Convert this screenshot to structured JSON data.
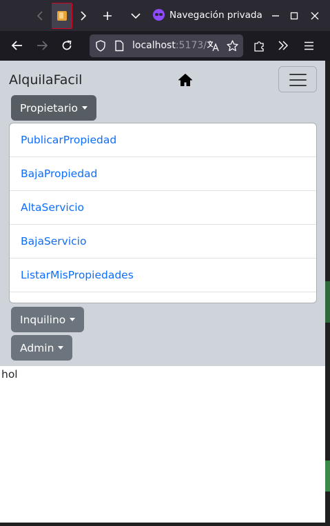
{
  "browser": {
    "private_label": "Navegación privada",
    "url_host": "localhost",
    "url_port": ":5173/"
  },
  "app": {
    "brand": "AlquilaFacil",
    "menus": [
      {
        "label": "Propietario",
        "expanded": true
      },
      {
        "label": "Inquilino",
        "expanded": false
      },
      {
        "label": "Admin",
        "expanded": false
      }
    ],
    "propietario_items": [
      "PublicarPropiedad",
      "BajaPropiedad",
      "AltaServicio",
      "BajaServicio",
      "ListarMisPropiedades"
    ]
  },
  "content": {
    "text": "hol"
  },
  "colors": {
    "tabbar_bg": "#2b2a33",
    "toolbar_bg": "#1c1b22",
    "navbar_bg": "#ced4da",
    "button_bg": "#6c757d",
    "link": "#0d6efd",
    "private_accent": "#8f4bff"
  }
}
